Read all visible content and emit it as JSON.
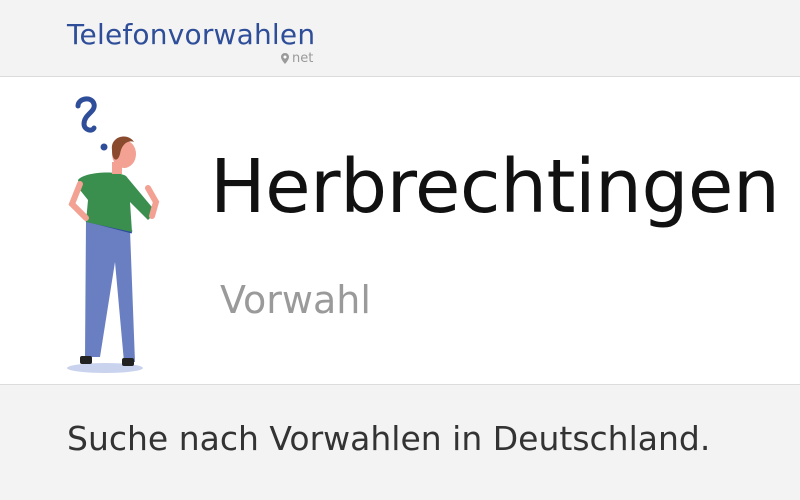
{
  "header": {
    "logo_text": "Telefonvorwahlen",
    "logo_suffix": "net"
  },
  "hero": {
    "city": "Herbrechtingen",
    "subtitle": "Vorwahl"
  },
  "footer": {
    "search_text": "Suche nach Vorwahlen in Deutschland."
  },
  "icons": {
    "logo_pin": "map-pin-icon",
    "illustration": "thinking-person-illustration"
  },
  "colors": {
    "brand": "#2f4e99",
    "muted": "#9a9a9a",
    "shirt": "#3a8f4f",
    "pants": "#6a7fc2"
  }
}
